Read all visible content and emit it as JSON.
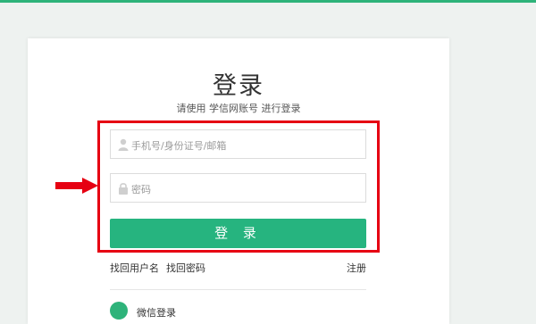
{
  "colors": {
    "accent": "#26b47f",
    "highlight_box": "#e60012",
    "arrow": "#e60012",
    "background": "#eef2f0"
  },
  "login": {
    "title": "登录",
    "subtitle": "请使用 学信网账号 进行登录",
    "username_placeholder": "手机号/身份证号/邮箱",
    "password_placeholder": "密码",
    "login_button": "登 录",
    "find_username": "找回用户名",
    "find_password": "找回密码",
    "register": "注册",
    "wechat_label": "微信登录"
  },
  "icons": {
    "username": "user-icon",
    "password": "lock-icon",
    "wechat": "wechat-icon",
    "annotation": "arrow-right-icon"
  }
}
